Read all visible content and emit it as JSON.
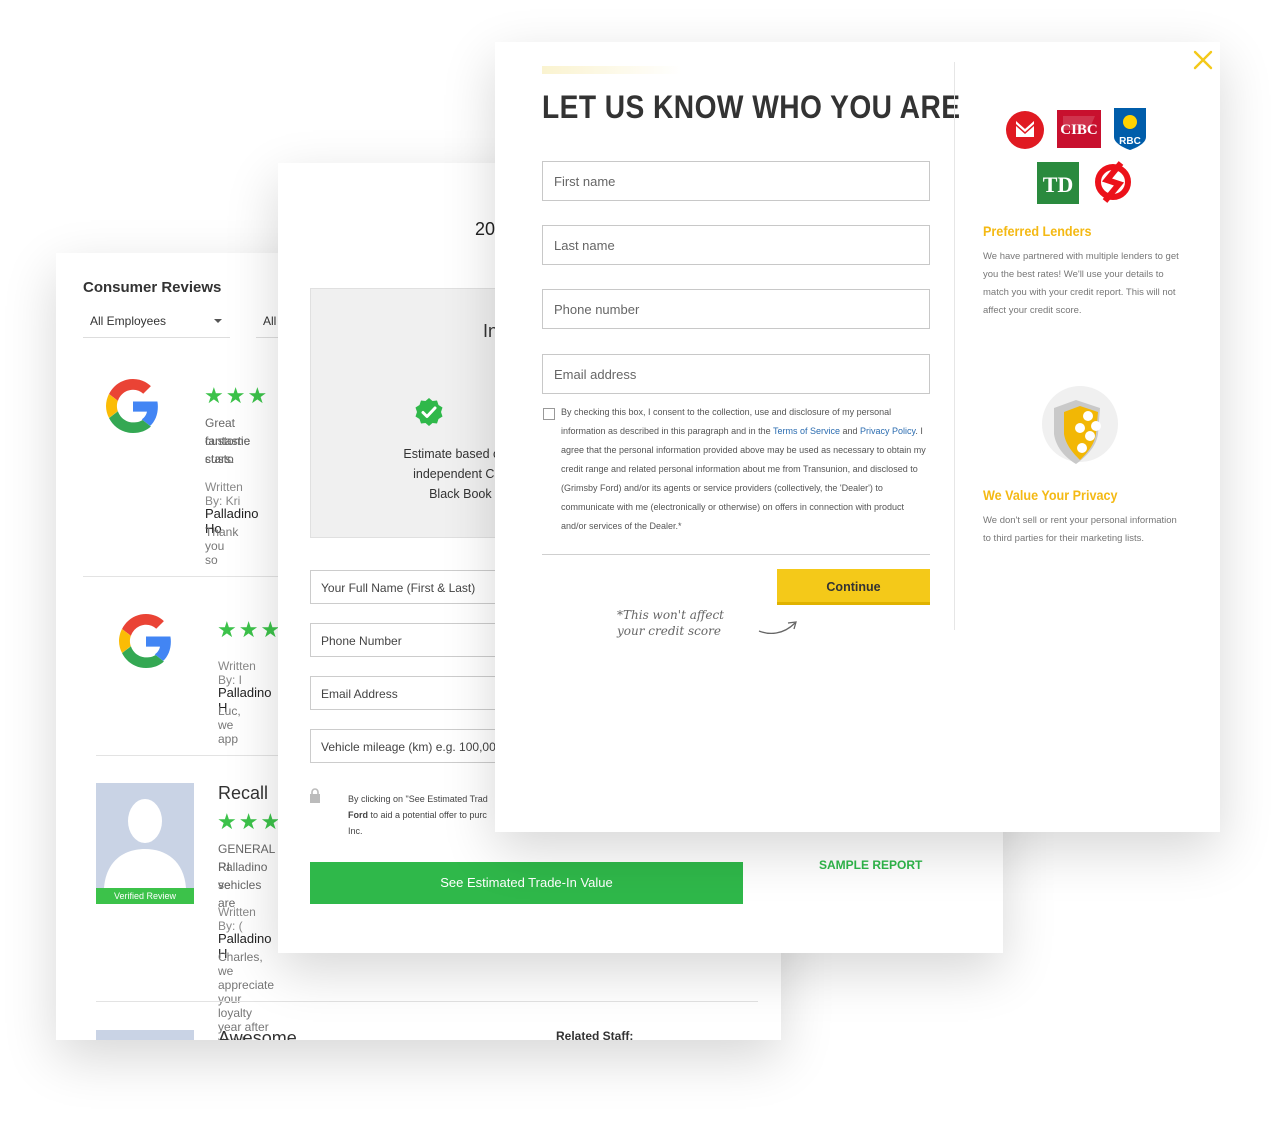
{
  "reviews": {
    "title": "Consumer Reviews",
    "filter_employees": "All Employees",
    "filter_other": "All",
    "items": [
      {
        "source_icon": "google-icon",
        "stars": "★★★",
        "text_line1": "Great custome",
        "text_line2": "fantastic custo",
        "text_line3": "stars.",
        "written_by": "Written By: Kri",
        "business": "Palladino Ho",
        "reply": "Thank you so"
      },
      {
        "source_icon": "google-icon",
        "stars": "★★★",
        "written_by": "Written By: I",
        "business": "Palladino H",
        "reply": "Luc, we app"
      },
      {
        "title": "Recall",
        "stars": "★★★",
        "badge": "Verified Review",
        "text_line1": "GENERAL RI",
        "text_line2": "Palladino se",
        "text_line3": "vehicles are",
        "written_by": "Written By: (",
        "business": "Palladino H",
        "reply": "Charles, we appreciate your loyalty year after year!"
      },
      {
        "title": "Awesome",
        "related_staff": "Related Staff:"
      }
    ]
  },
  "trade": {
    "year_partial": "20",
    "heading_partial": "In",
    "estimate_line1": "Estimate based on trusted",
    "estimate_line2": "independent Canadian",
    "estimate_line3": "Black Book data.",
    "fields": [
      {
        "placeholder": "Your Full Name (First & Last)"
      },
      {
        "placeholder": "Phone Number"
      },
      {
        "placeholder": "Email Address"
      },
      {
        "placeholder": "Vehicle mileage (km) e.g. 100,000"
      }
    ],
    "consent_line1": "By clicking on \"See Estimated Trad",
    "consent_line2_bold": "Ford",
    "consent_line2_rest": " to aid a potential offer to purc",
    "consent_line3": "Inc.",
    "button_label": "See Estimated Trade-In Value",
    "sample_report": "SAMPLE REPORT"
  },
  "modal": {
    "title": "LET US KNOW WHO YOU ARE",
    "fields": [
      {
        "placeholder": "First name"
      },
      {
        "placeholder": "Last name"
      },
      {
        "placeholder": "Phone number"
      },
      {
        "placeholder": "Email address"
      }
    ],
    "consent_part1": "By checking this box, I consent to the collection, use and disclosure of my personal information as described in this paragraph and in the ",
    "terms_link": "Terms of Service",
    "consent_and": " and ",
    "privacy_link": "Privacy Policy",
    "consent_part2": ". I agree that the personal information provided above may be used as necessary to obtain my credit range and related personal information about me from Transunion, and disclosed to (Grimsby Ford) and/or its agents or service providers (collectively, the 'Dealer') to communicate with me (electronically or otherwise) on offers in connection with product and/or services of the Dealer.*",
    "continue_label": "Continue",
    "credit_note_line1": "*This won't affect",
    "credit_note_line2": "your credit score",
    "banks": [
      "BMO",
      "CIBC",
      "RBC",
      "TD",
      "Scotiabank"
    ],
    "preferred_heading": "Preferred Lenders",
    "preferred_text": "We have partnered with multiple lenders to get you the best rates! We'll use your details to match you with your credit report. This will not affect your credit score.",
    "privacy_heading": "We Value Your Privacy",
    "privacy_text": "We don't sell or rent your personal information to third parties for their marketing lists.",
    "colors": {
      "accent": "#f4c919",
      "heading": "#f4b914",
      "green": "#2fb84a"
    }
  }
}
